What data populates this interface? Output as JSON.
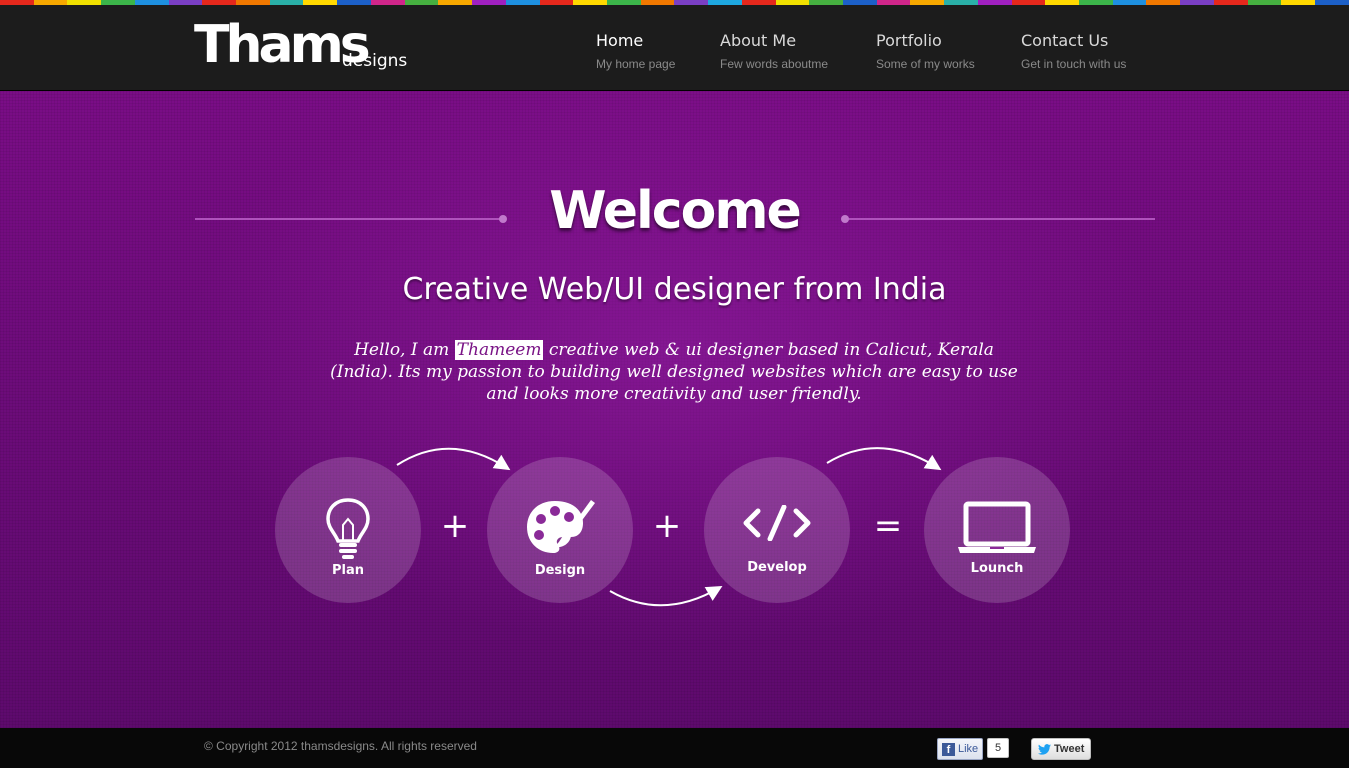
{
  "colors": {
    "rainbow": [
      "#e5281c",
      "#f7a800",
      "#f0e000",
      "#3cb54a",
      "#1e90e0",
      "#7a3fc4",
      "#e5281c",
      "#f07800",
      "#2ab0a8",
      "#ffd800",
      "#1c60c8",
      "#d0268a",
      "#46b040",
      "#f7a800",
      "#a020c0",
      "#1e90e0",
      "#e5281c",
      "#ffd800",
      "#3cb54a",
      "#f07800",
      "#7a3fc4",
      "#1ea8e0",
      "#e5281c",
      "#f0e000",
      "#46b040",
      "#1c60c8",
      "#d0268a",
      "#f7a800",
      "#2ab0a8",
      "#a020c0",
      "#e5281c",
      "#ffd800",
      "#3cb54a",
      "#1e90e0",
      "#f07800",
      "#7a3fc4",
      "#e5281c",
      "#46b040",
      "#ffd800",
      "#1c60c8"
    ],
    "accent": "#7a0d86"
  },
  "logo": {
    "big": "Thams",
    "small": "designs"
  },
  "nav": [
    {
      "label": "Home",
      "sub": "My home page",
      "active": true
    },
    {
      "label": "About Me",
      "sub": "Few words aboutme",
      "active": false
    },
    {
      "label": "Portfolio",
      "sub": "Some of my works",
      "active": false
    },
    {
      "label": "Contact Us",
      "sub": "Get in touch with us",
      "active": false
    }
  ],
  "hero": {
    "title": "Welcome",
    "subtitle": "Creative Web/UI designer from India",
    "intro_before": "Hello, I am",
    "intro_name": "Thameem",
    "intro_after": "creative web & ui designer based in Calicut, Kerala (India). Its my passion to building well designed websites which are easy to use and looks more creativity and user friendly."
  },
  "steps": [
    {
      "label": "Plan",
      "icon": "lightbulb-icon"
    },
    {
      "label": "Design",
      "icon": "palette-icon"
    },
    {
      "label": "Develop",
      "icon": "code-icon"
    },
    {
      "label": "Lounch",
      "icon": "laptop-icon"
    }
  ],
  "operators": [
    "+",
    "+",
    "="
  ],
  "footer": {
    "copyright": "© Copyright 2012 thamsdesigns. All rights reserved",
    "like_label": "Like",
    "like_count": "5",
    "tweet_label": "Tweet"
  }
}
